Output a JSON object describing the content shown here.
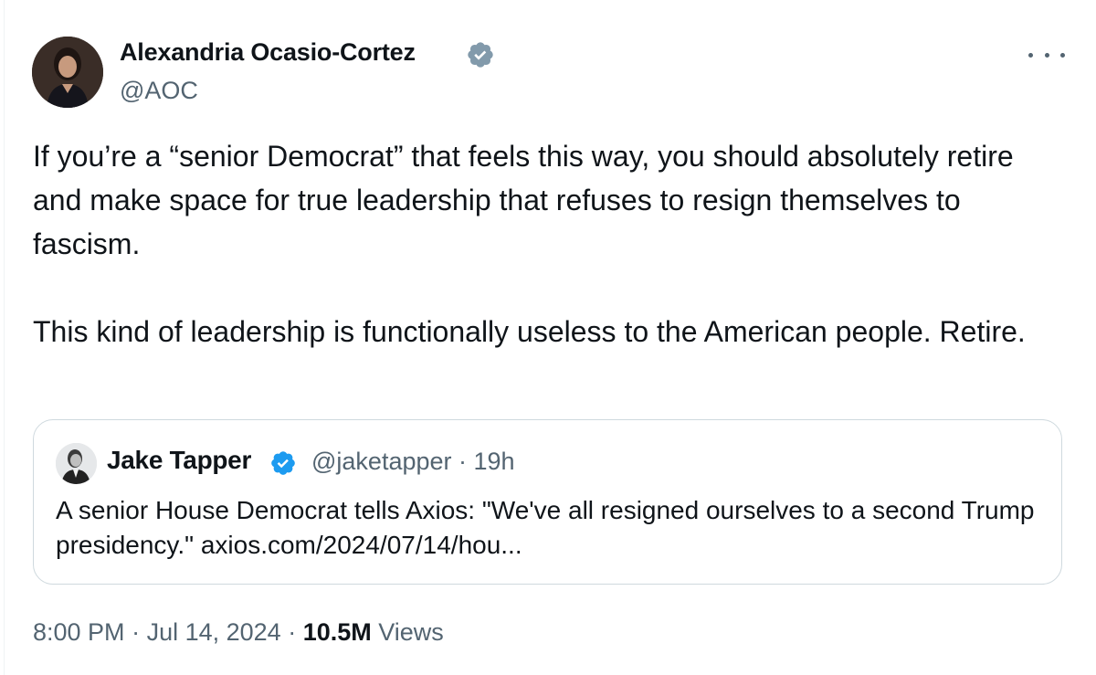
{
  "author": {
    "name": "Alexandria Ocasio-Cortez",
    "handle": "@AOC",
    "verified": true,
    "avatar_icon": "profile-photo-icon"
  },
  "tweet": {
    "paragraph_1": "If you’re a “senior Democrat” that feels this way, you should absolutely retire and make space for true leadership that refuses to resign themselves to fascism.",
    "paragraph_2": "This kind of leadership is functionally useless to the American people. Retire."
  },
  "quoted_tweet": {
    "name": "Jake Tapper",
    "handle": "@jaketapper",
    "separator": " · ",
    "age": "19h",
    "verified": true,
    "text": "A senior House Democrat tells Axios: \"We've all resigned ourselves to a second Trump  presidency.\"  axios.com/2024/07/14/hou..."
  },
  "meta": {
    "time": "8:00 PM",
    "separator": " · ",
    "date": "Jul 14, 2024",
    "separator_2": " · ",
    "views_count": "10.5M",
    "views_label": " Views"
  },
  "more_icon": "more-horizontal-icon",
  "colors": {
    "verified": "#1d9bf0",
    "verified_author": "#829aab",
    "secondary_text": "#536471",
    "primary_text": "#0f1419",
    "border": "#cfd9de"
  }
}
